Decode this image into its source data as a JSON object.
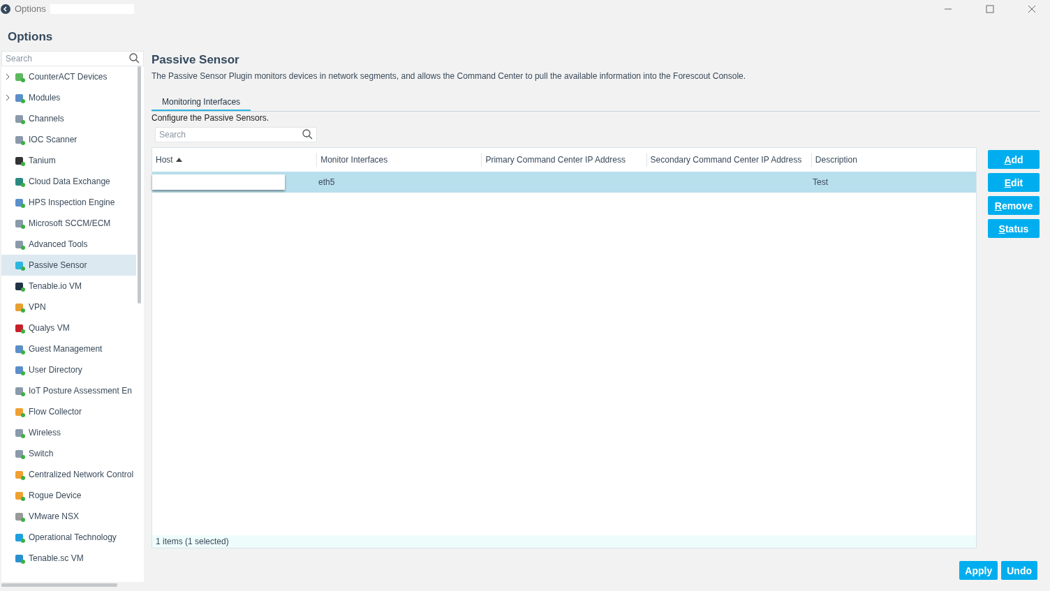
{
  "window": {
    "title": "Options"
  },
  "heading": "Options",
  "sidebar": {
    "search": {
      "placeholder": "Search"
    },
    "items": [
      {
        "label": "CounterACT Devices",
        "expandable": true,
        "selected": false
      },
      {
        "label": "Modules",
        "expandable": true,
        "selected": false
      },
      {
        "label": "Channels",
        "expandable": false,
        "selected": false
      },
      {
        "label": "IOC Scanner",
        "expandable": false,
        "selected": false
      },
      {
        "label": "Tanium",
        "expandable": false,
        "selected": false
      },
      {
        "label": "Cloud Data Exchange",
        "expandable": false,
        "selected": false
      },
      {
        "label": "HPS Inspection Engine",
        "expandable": false,
        "selected": false
      },
      {
        "label": "Microsoft SCCM/ECM",
        "expandable": false,
        "selected": false
      },
      {
        "label": "Advanced Tools",
        "expandable": false,
        "selected": false
      },
      {
        "label": "Passive Sensor",
        "expandable": false,
        "selected": true
      },
      {
        "label": "Tenable.io VM",
        "expandable": false,
        "selected": false
      },
      {
        "label": "VPN",
        "expandable": false,
        "selected": false
      },
      {
        "label": "Qualys VM",
        "expandable": false,
        "selected": false
      },
      {
        "label": "Guest Management",
        "expandable": false,
        "selected": false
      },
      {
        "label": "User Directory",
        "expandable": false,
        "selected": false
      },
      {
        "label": "IoT Posture Assessment En",
        "expandable": false,
        "selected": false
      },
      {
        "label": "Flow Collector",
        "expandable": false,
        "selected": false
      },
      {
        "label": "Wireless",
        "expandable": false,
        "selected": false
      },
      {
        "label": "Switch",
        "expandable": false,
        "selected": false
      },
      {
        "label": "Centralized Network Control",
        "expandable": false,
        "selected": false
      },
      {
        "label": "Rogue Device",
        "expandable": false,
        "selected": false
      },
      {
        "label": "VMware NSX",
        "expandable": false,
        "selected": false
      },
      {
        "label": "Operational Technology",
        "expandable": false,
        "selected": false
      },
      {
        "label": "Tenable.sc VM",
        "expandable": false,
        "selected": false
      }
    ]
  },
  "panel": {
    "title": "Passive Sensor",
    "description": "The Passive Sensor Plugin monitors devices in network segments, and allows the Command Center to pull the available information into the Forescout Console.",
    "tabs": [
      {
        "label": "Monitoring Interfaces",
        "selected": true
      }
    ],
    "instruction": "Configure the Passive Sensors.",
    "search": {
      "placeholder": "Search"
    },
    "table": {
      "columns": [
        {
          "label": "Host",
          "sorted": true
        },
        {
          "label": "Monitor Interfaces",
          "sorted": false
        },
        {
          "label": "Primary Command Center IP Address",
          "sorted": false
        },
        {
          "label": "Secondary Command Center IP Address",
          "sorted": false
        },
        {
          "label": "Description",
          "sorted": false
        }
      ],
      "rows": [
        {
          "selected": true,
          "cells": [
            "",
            "eth5",
            "",
            "",
            "Test"
          ]
        }
      ],
      "footer": "1 items (1 selected)"
    },
    "side_buttons": [
      "Add",
      "Edit",
      "Remove",
      "Status"
    ],
    "bottom_buttons": [
      "Apply",
      "Undo"
    ]
  }
}
